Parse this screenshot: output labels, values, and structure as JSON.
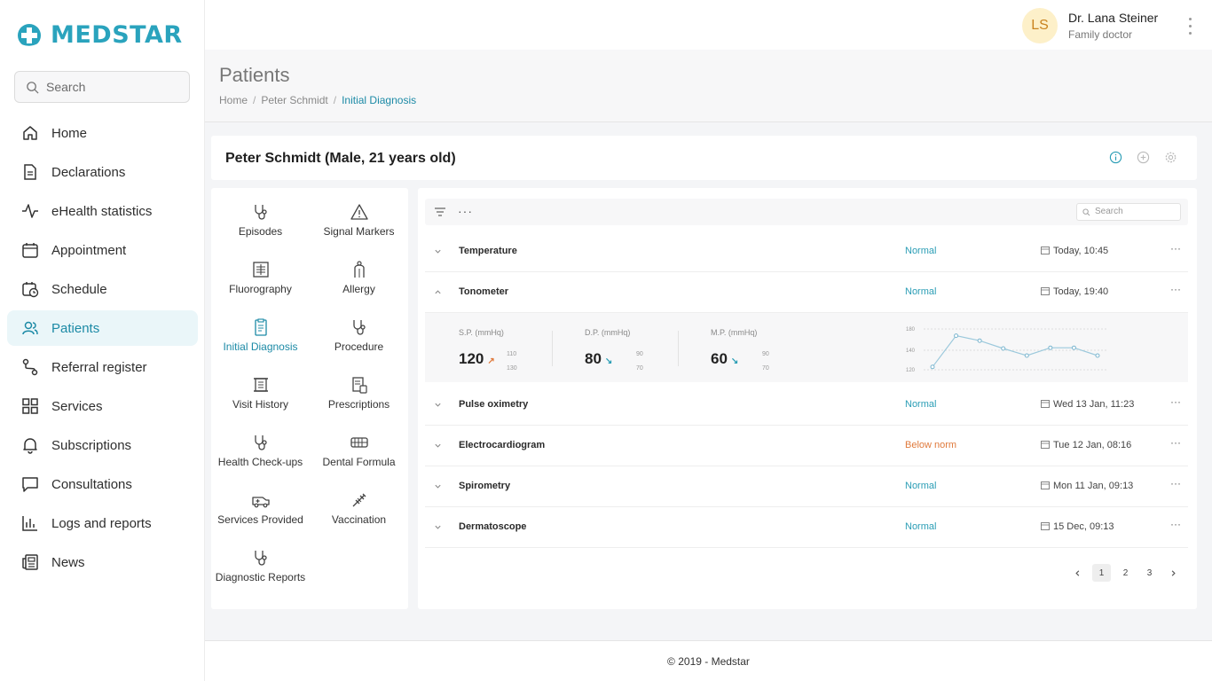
{
  "brand": {
    "name": "MEDSTAR",
    "color": "#2aa3bd"
  },
  "search": {
    "placeholder": "Search"
  },
  "nav": [
    {
      "label": "Home",
      "icon": "home-icon"
    },
    {
      "label": "Declarations",
      "icon": "document-icon"
    },
    {
      "label": "eHealth statistics",
      "icon": "pulse-icon"
    },
    {
      "label": "Appointment",
      "icon": "calendar-icon"
    },
    {
      "label": "Schedule",
      "icon": "calendar-clock-icon"
    },
    {
      "label": "Patients",
      "icon": "users-icon",
      "active": true
    },
    {
      "label": "Referral register",
      "icon": "route-icon"
    },
    {
      "label": "Services",
      "icon": "grid-icon"
    },
    {
      "label": "Subscriptions",
      "icon": "bell-icon"
    },
    {
      "label": "Consultations",
      "icon": "chat-icon"
    },
    {
      "label": "Logs and reports",
      "icon": "bar-chart-icon"
    },
    {
      "label": "News",
      "icon": "newspaper-icon"
    }
  ],
  "user": {
    "initials": "LS",
    "name": "Dr. Lana Steiner",
    "role": "Family doctor"
  },
  "page": {
    "title": "Patients",
    "breadcrumb": [
      "Home",
      "Peter Schmidt",
      "Initial Diagnosis"
    ]
  },
  "patient": {
    "header": "Peter Schmidt (Male, 21 years old)"
  },
  "categories": [
    {
      "label": "Episodes",
      "icon": "stethoscope-icon"
    },
    {
      "label": "Signal Markers",
      "icon": "warning-icon"
    },
    {
      "label": "Fluorography",
      "icon": "xray-icon"
    },
    {
      "label": "Allergy",
      "icon": "body-icon"
    },
    {
      "label": "Initial Diagnosis",
      "icon": "clipboard-icon",
      "active": true
    },
    {
      "label": "Procedure",
      "icon": "stethoscope-icon"
    },
    {
      "label": "Visit History",
      "icon": "scroll-icon"
    },
    {
      "label": "Prescriptions",
      "icon": "prescription-icon"
    },
    {
      "label": "Health Check-ups",
      "icon": "stethoscope-icon"
    },
    {
      "label": "Dental Formula",
      "icon": "teeth-icon"
    },
    {
      "label": "Services Provided",
      "icon": "ambulance-icon"
    },
    {
      "label": "Vaccination",
      "icon": "syringe-icon"
    },
    {
      "label": "Diagnostic Reports",
      "icon": "stethoscope-icon"
    }
  ],
  "table": {
    "search_placeholder": "Search",
    "toolbar_more": "···",
    "rows": [
      {
        "name": "Temperature",
        "status": "Normal",
        "date": "Today, 10:45",
        "expanded": false
      },
      {
        "name": "Tonometer",
        "status": "Normal",
        "date": "Today, 19:40",
        "expanded": true
      },
      {
        "name": "Pulse oximetry",
        "status": "Normal",
        "date": "Wed 13 Jan, 11:23",
        "expanded": false
      },
      {
        "name": "Electrocardiogram",
        "status": "Below norm",
        "date": "Tue 12 Jan, 08:16",
        "expanded": false
      },
      {
        "name": "Spirometry",
        "status": "Normal",
        "date": "Mon 11 Jan, 09:13",
        "expanded": false
      },
      {
        "name": "Dermatoscope",
        "status": "Normal",
        "date": "15 Dec, 09:13",
        "expanded": false
      }
    ],
    "row_more": "···",
    "tonometer": {
      "metrics": [
        {
          "label": "S.P. (mmHq)",
          "value": "120",
          "trend": "up",
          "range_high": "110",
          "range_low": "130"
        },
        {
          "label": "D.P. (mmHq)",
          "value": "80",
          "trend": "down",
          "range_high": "90",
          "range_low": "70"
        },
        {
          "label": "M.P. (mmHq)",
          "value": "60",
          "trend": "down",
          "range_high": "90",
          "range_low": "70"
        }
      ],
      "chart_data": {
        "type": "line",
        "y_ticks": [
          "180",
          "140",
          "120"
        ],
        "ylim": [
          120,
          180
        ],
        "grid": true,
        "series": [
          {
            "values": [
              124,
              168,
              161,
              150,
              140,
              151,
              151,
              140
            ]
          }
        ]
      }
    },
    "pagination": {
      "pages": [
        "1",
        "2",
        "3"
      ],
      "current": "1"
    }
  },
  "footer": {
    "text": "© 2019 - Medstar"
  },
  "colors": {
    "accent": "#2a9db5",
    "warn": "#e07a3c",
    "active_bg": "#eaf6f9"
  }
}
